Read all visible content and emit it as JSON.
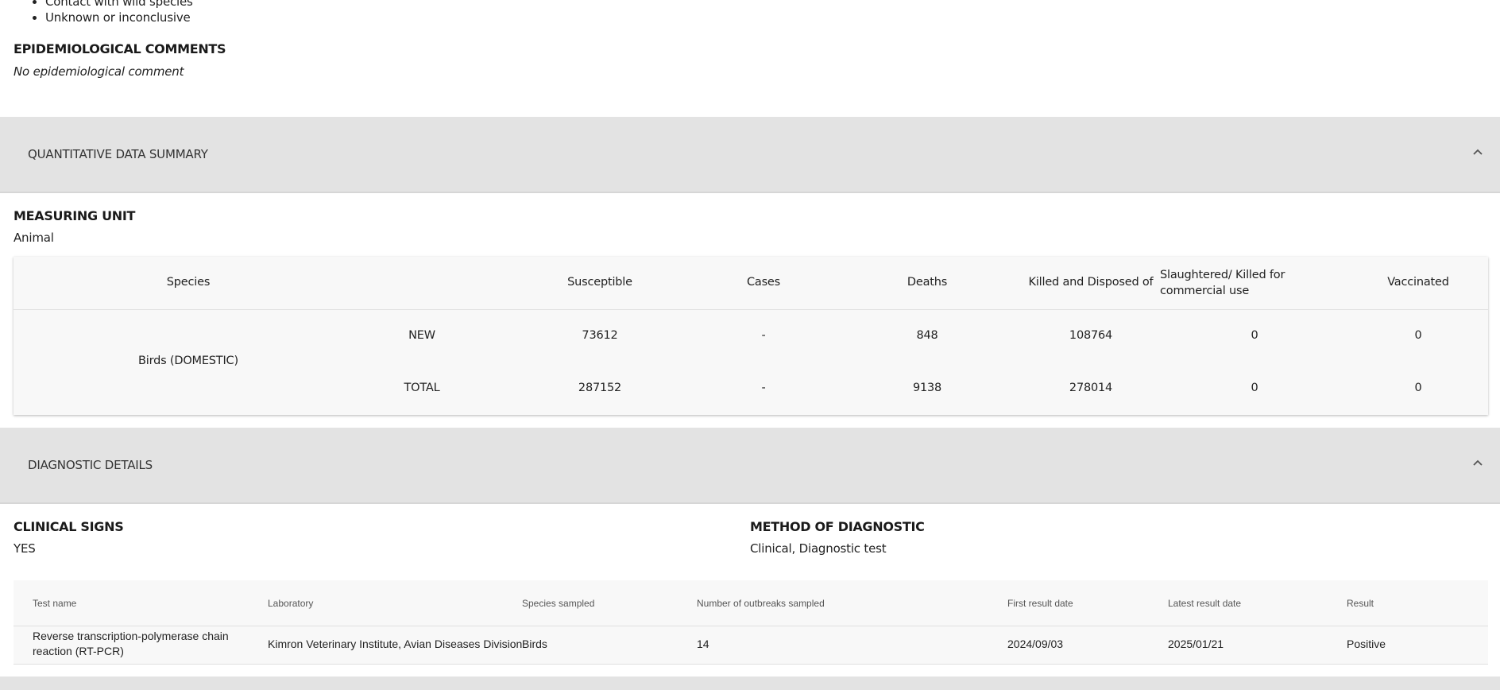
{
  "transmission_sources": {
    "items": [
      "Contact with wild species",
      "Unknown or inconclusive"
    ]
  },
  "epidemiological_comments": {
    "heading": "EPIDEMIOLOGICAL COMMENTS",
    "text": "No epidemiological comment"
  },
  "quantitative_section": {
    "title": "QUANTITATIVE DATA SUMMARY",
    "toggle_icon": "chevron-up-icon"
  },
  "measuring_unit": {
    "heading": "MEASURING UNIT",
    "value": "Animal"
  },
  "quantitative_table": {
    "headers": {
      "species": "Species",
      "susceptible": "Susceptible",
      "cases": "Cases",
      "deaths": "Deaths",
      "killed": "Killed and Disposed of",
      "slaughtered": "Slaughtered/ Killed for commercial use",
      "vaccinated": "Vaccinated"
    },
    "species": "Birds (DOMESTIC)",
    "rows": [
      {
        "label": "NEW",
        "susceptible": "73612",
        "cases": "-",
        "deaths": "848",
        "killed": "108764",
        "slaughtered": "0",
        "vaccinated": "0"
      },
      {
        "label": "TOTAL",
        "susceptible": "287152",
        "cases": "-",
        "deaths": "9138",
        "killed": "278014",
        "slaughtered": "0",
        "vaccinated": "0"
      }
    ]
  },
  "diagnostic_section": {
    "title": "DIAGNOSTIC DETAILS",
    "toggle_icon": "chevron-up-icon"
  },
  "clinical_signs": {
    "heading": "CLINICAL SIGNS",
    "value": "YES"
  },
  "method_of_diagnostic": {
    "heading": "METHOD OF DIAGNOSTIC",
    "value": "Clinical, Diagnostic test"
  },
  "diagnostic_table": {
    "headers": {
      "test_name": "Test name",
      "laboratory": "Laboratory",
      "species_sampled": "Species sampled",
      "outbreaks": "Number of outbreaks sampled",
      "first_date": "First result date",
      "latest_date": "Latest result date",
      "result": "Result"
    },
    "rows": [
      {
        "test_name": "Reverse transcription-polymerase chain reaction (RT-PCR)",
        "laboratory": "Kimron Veterinary Institute, Avian Diseases Division",
        "species_sampled": "Birds",
        "outbreaks": "14",
        "first_date": "2024/09/03",
        "latest_date": "2025/01/21",
        "result": "Positive"
      }
    ]
  }
}
